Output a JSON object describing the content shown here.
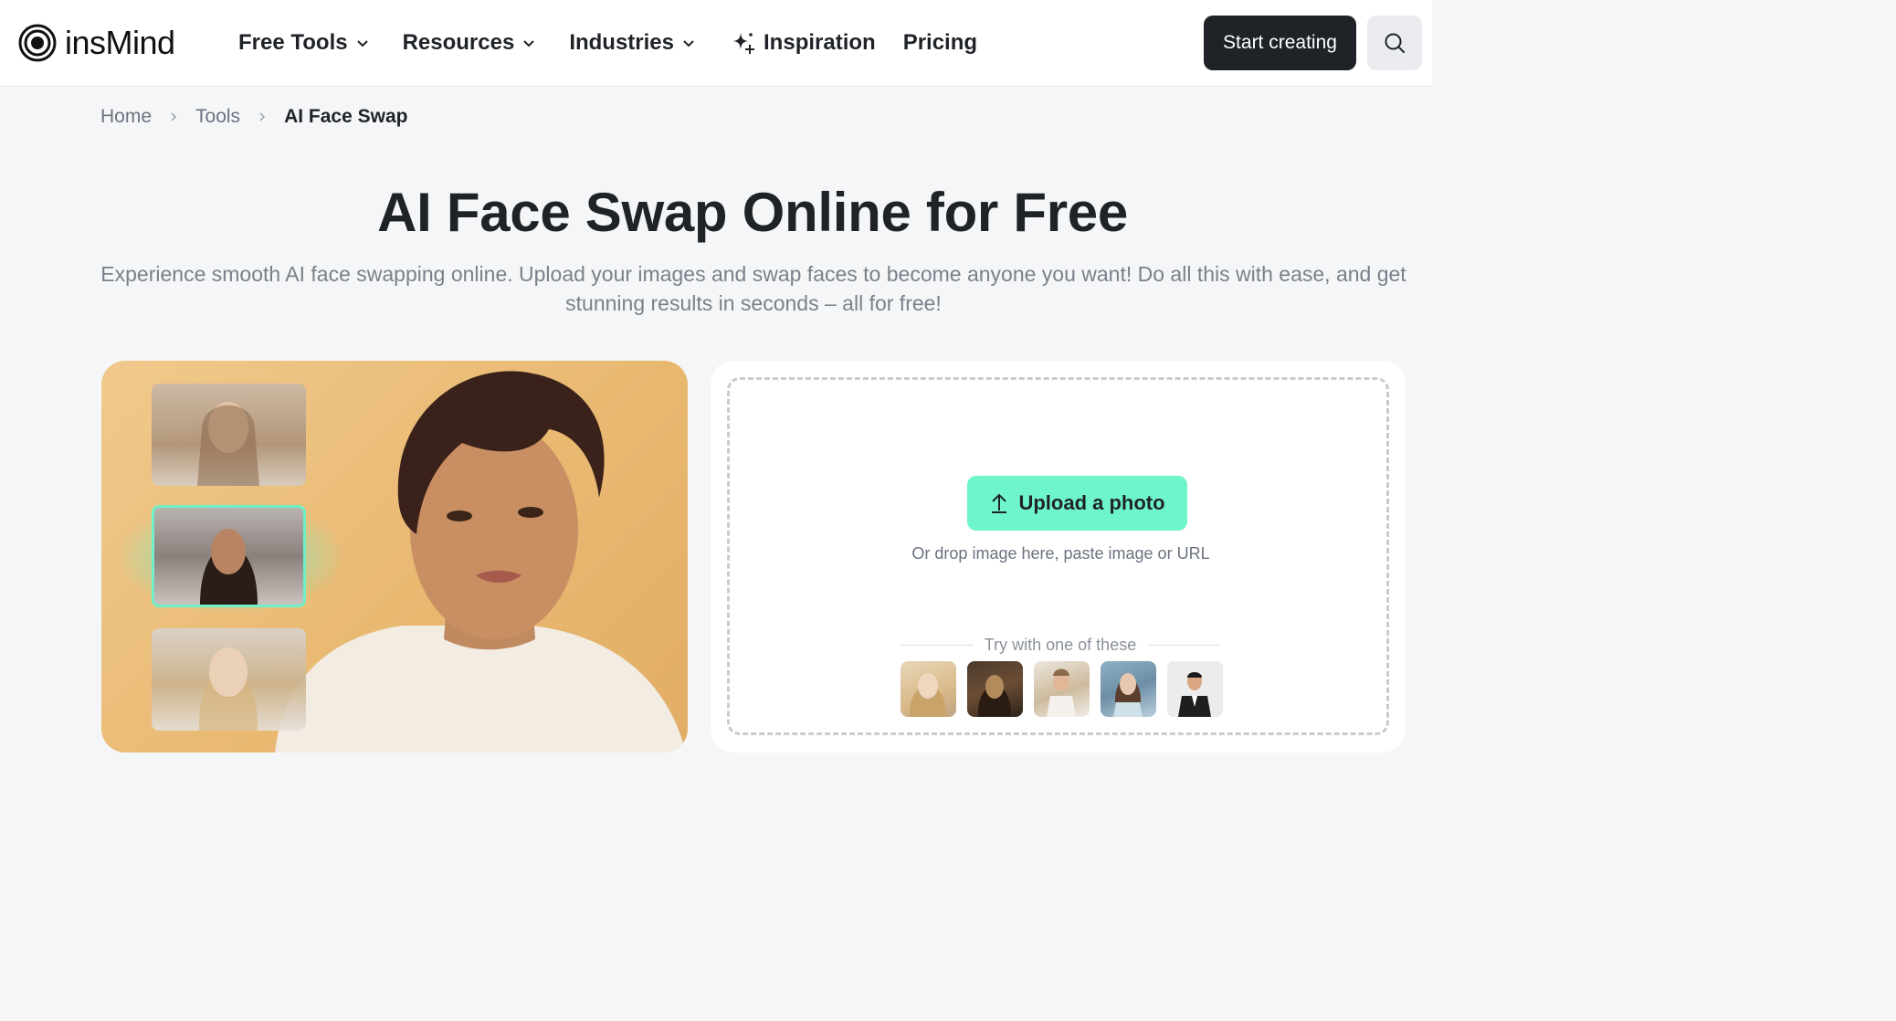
{
  "header": {
    "brand": "insMind",
    "nav": {
      "free_tools": "Free Tools",
      "resources": "Resources",
      "industries": "Industries",
      "inspiration": "Inspiration",
      "pricing": "Pricing"
    },
    "start_label": "Start creating"
  },
  "breadcrumb": {
    "home": "Home",
    "tools": "Tools",
    "current": "AI Face Swap"
  },
  "hero": {
    "title": "AI Face Swap Online for Free",
    "subtitle": "Experience smooth AI face swapping online. Upload your images and swap faces to become anyone you want! Do all this with ease, and get stunning results in seconds – all for free!"
  },
  "upload": {
    "button_label": "Upload a photo",
    "hint": "Or drop image here, paste image or URL",
    "try_label": "Try with one of these"
  },
  "colors": {
    "accent": "#6ff5cb",
    "dark": "#1f2328"
  }
}
